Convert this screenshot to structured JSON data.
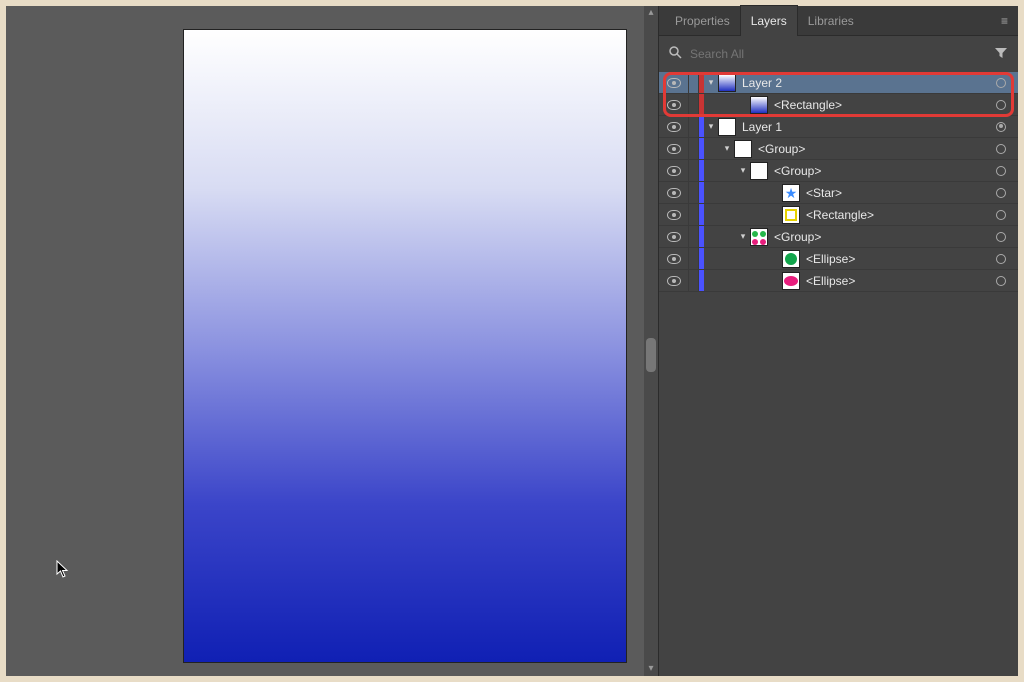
{
  "panel": {
    "tabs": {
      "properties": "Properties",
      "layers": "Layers",
      "libraries": "Libraries",
      "active": "Layers"
    },
    "search": {
      "placeholder": "Search All"
    }
  },
  "layers": [
    {
      "id": "layer2",
      "label": "Layer 2",
      "indent": 0,
      "expanded": true,
      "stripe": "red",
      "thumb": "th-grad",
      "selected": true,
      "target": "ring"
    },
    {
      "id": "rect2",
      "label": "<Rectangle>",
      "indent": 2,
      "expanded": null,
      "stripe": "red",
      "thumb": "th-grad",
      "selected": false,
      "target": "ring"
    },
    {
      "id": "layer1",
      "label": "Layer 1",
      "indent": 0,
      "expanded": true,
      "stripe": "blue",
      "thumb": "th-multi",
      "selected": false,
      "target": "filled"
    },
    {
      "id": "group1",
      "label": "<Group>",
      "indent": 1,
      "expanded": true,
      "stripe": "blue",
      "thumb": "th-multi",
      "selected": false,
      "target": "ring"
    },
    {
      "id": "group2",
      "label": "<Group>",
      "indent": 2,
      "expanded": true,
      "stripe": "blue",
      "thumb": "th-multi",
      "selected": false,
      "target": "ring"
    },
    {
      "id": "star",
      "label": "<Star>",
      "indent": 4,
      "expanded": null,
      "stripe": "blue",
      "thumb": "th-star",
      "selected": false,
      "target": "ring"
    },
    {
      "id": "rect1",
      "label": "<Rectangle>",
      "indent": 4,
      "expanded": null,
      "stripe": "blue",
      "thumb": "th-rect",
      "selected": false,
      "target": "ring"
    },
    {
      "id": "group3",
      "label": "<Group>",
      "indent": 2,
      "expanded": true,
      "stripe": "blue",
      "thumb": "th-dots",
      "selected": false,
      "target": "ring"
    },
    {
      "id": "ellipse1",
      "label": "<Ellipse>",
      "indent": 4,
      "expanded": null,
      "stripe": "blue",
      "thumb": "th-ell-g",
      "selected": false,
      "target": "ring"
    },
    {
      "id": "ellipse2",
      "label": "<Ellipse>",
      "indent": 4,
      "expanded": null,
      "stripe": "blue",
      "thumb": "th-ell-p",
      "selected": false,
      "target": "ring"
    }
  ],
  "colors": {
    "highlight_border": "#e13a36",
    "stripe_red": "#c73434",
    "stripe_blue": "#4a52ff",
    "gradient_top": "#ffffff",
    "gradient_bottom": "#1020b4"
  }
}
